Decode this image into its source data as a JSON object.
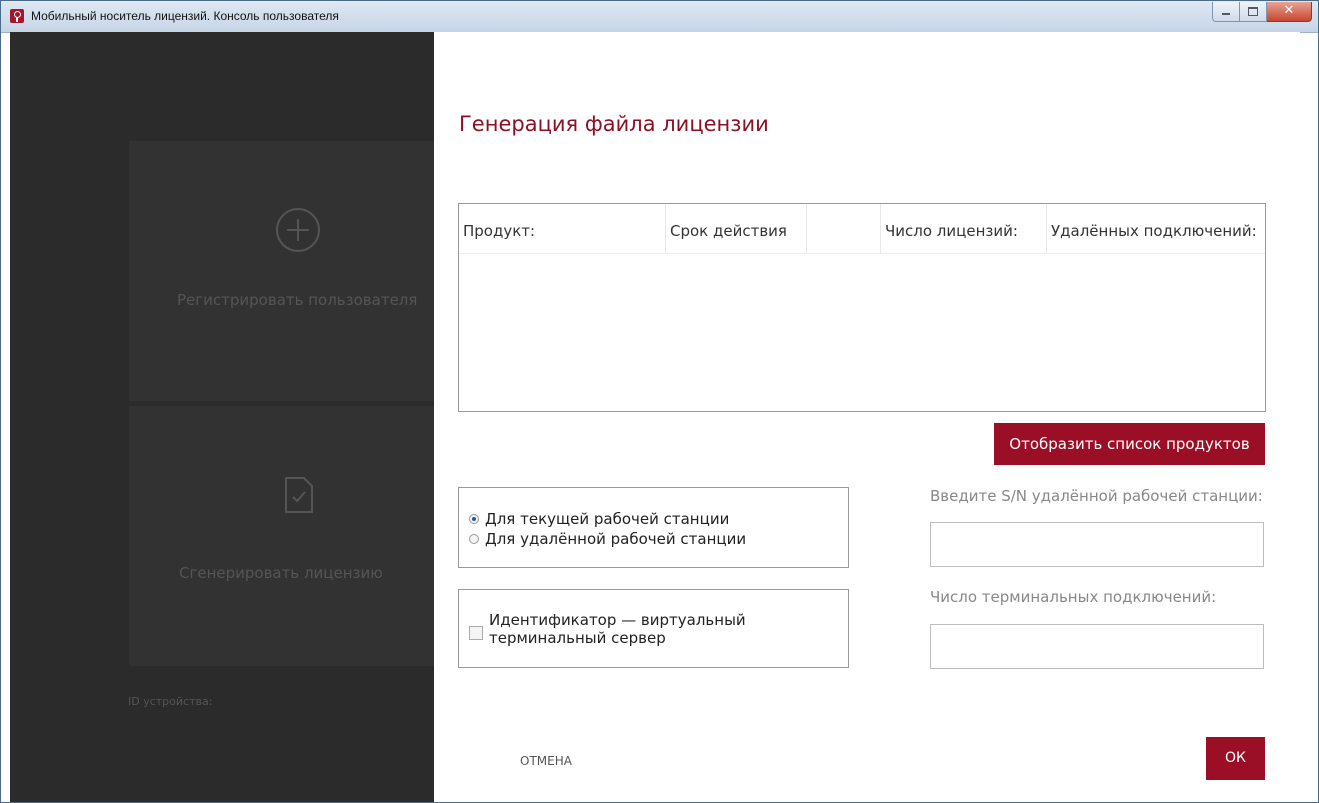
{
  "window": {
    "title": "Мобильный носитель лицензий. Консоль пользователя"
  },
  "background": {
    "tiles": [
      {
        "label": "Регистрировать пользователя",
        "icon": "plus-circle-icon"
      },
      {
        "label": "Сгенерировать лицензию",
        "icon": "document-check-icon"
      }
    ],
    "device_id_label": "ID устройства:"
  },
  "dialog": {
    "title": "Генерация файла лицензии",
    "table": {
      "columns": [
        "Продукт:",
        "Срок действия",
        "",
        "Число лицензий:",
        "Удалённых подключений:"
      ],
      "rows": []
    },
    "show_products_label": "Отобразить список продуктов",
    "workstation_options": [
      {
        "label": "Для текущей рабочей станции",
        "selected": true
      },
      {
        "label": "Для удалённой рабочей станции",
        "selected": false
      }
    ],
    "virtual_server": {
      "label": "Идентификатор — виртуальный терминальный сервер",
      "checked": false
    },
    "remote_sn_label": "Введите S/N удалённой рабочей станции:",
    "remote_sn_value": "",
    "terminal_count_label": "Число терминальных подключений:",
    "terminal_count_value": "",
    "cancel_label": "ОТМЕНА",
    "ok_label": "ОК"
  },
  "colors": {
    "accent": "#9b0f26",
    "title": "#8e1025",
    "dark_panel": "#2b2b2b"
  }
}
